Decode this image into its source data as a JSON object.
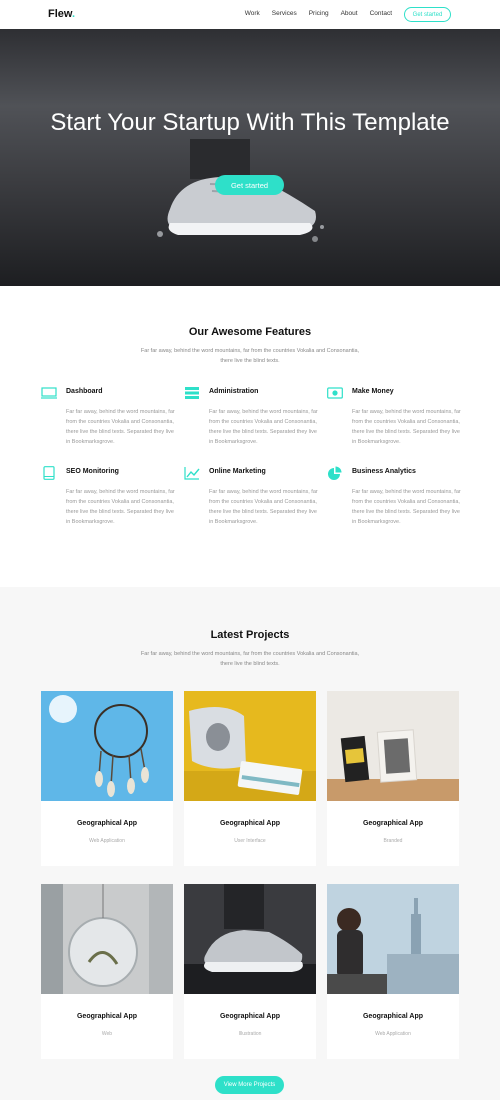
{
  "nav": {
    "logo": "Flew",
    "logo_dot": ".",
    "items": [
      {
        "label": "Work"
      },
      {
        "label": "Services"
      },
      {
        "label": "Pricing"
      },
      {
        "label": "About"
      },
      {
        "label": "Contact"
      }
    ],
    "cta": "Get started"
  },
  "hero": {
    "title": "Start Your Startup With This Template",
    "button": "Get started"
  },
  "features": {
    "title": "Our Awesome Features",
    "subtitle": "Far far away, behind the word mountains, far from the countries Vokalia and Consonantia, there live the blind texts.",
    "items": [
      {
        "name": "Dashboard",
        "icon": "monitor-icon",
        "desc": "Far far away, behind the word mountains, far from the countries Vokalia and Consonantia, there live the blind texts. Separated they live in Bookmarksgrove."
      },
      {
        "name": "Administration",
        "icon": "server-icon",
        "desc": "Far far away, behind the word mountains, far from the countries Vokalia and Consonantia, there live the blind texts. Separated they live in Bookmarksgrove."
      },
      {
        "name": "Make Money",
        "icon": "money-icon",
        "desc": "Far far away, behind the word mountains, far from the countries Vokalia and Consonantia, there live the blind texts. Separated they live in Bookmarksgrove."
      },
      {
        "name": "SEO Monitoring",
        "icon": "tablet-icon",
        "desc": "Far far away, behind the word mountains, far from the countries Vokalia and Consonantia, there live the blind texts. Separated they live in Bookmarksgrove."
      },
      {
        "name": "Online Marketing",
        "icon": "trend-chart-icon",
        "desc": "Far far away, behind the word mountains, far from the countries Vokalia and Consonantia, there live the blind texts. Separated they live in Bookmarksgrove."
      },
      {
        "name": "Business Analytics",
        "icon": "pie-chart-icon",
        "desc": "Far far away, behind the word mountains, far from the countries Vokalia and Consonantia, there live the blind texts. Separated they live in Bookmarksgrove."
      }
    ]
  },
  "projects": {
    "title": "Latest Projects",
    "subtitle": "Far far away, behind the word mountains, far from the countries Vokalia and Consonantia, there live the blind texts.",
    "cards": [
      {
        "name": "Geographical App",
        "category": "Web Application"
      },
      {
        "name": "Geographical App",
        "category": "User Interface"
      },
      {
        "name": "Geographical App",
        "category": "Branded"
      },
      {
        "name": "Geographical App",
        "category": "Web"
      },
      {
        "name": "Geographical App",
        "category": "Illustration"
      },
      {
        "name": "Geographical App",
        "category": "Web Application"
      }
    ],
    "more_button": "View More Projects"
  },
  "colors": {
    "accent": "#2ee0c9",
    "dark": "#111111",
    "muted": "#999999"
  }
}
